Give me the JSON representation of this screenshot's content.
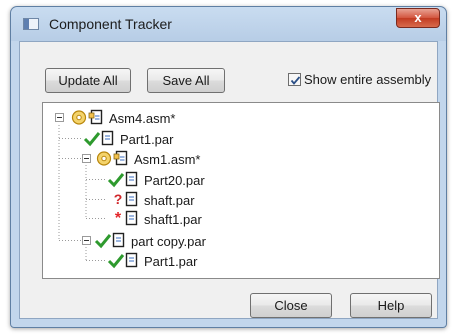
{
  "window": {
    "title": "Component Tracker",
    "close_glyph": "x"
  },
  "toolbar": {
    "update_all": "Update All",
    "save_all": "Save All",
    "show_entire_assembly": "Show entire assembly",
    "show_entire_assembly_checked": true
  },
  "tree": {
    "nodes": [
      {
        "label": "Asm4.asm*",
        "status": "out-of-date",
        "type": "assembly",
        "level": 0,
        "expanded": true
      },
      {
        "label": "Part1.par",
        "status": "up-to-date",
        "type": "part",
        "level": 1
      },
      {
        "label": "Asm1.asm*",
        "status": "out-of-date",
        "type": "assembly",
        "level": 1,
        "expanded": true
      },
      {
        "label": "Part20.par",
        "status": "up-to-date",
        "type": "part",
        "level": 2
      },
      {
        "label": "shaft.par",
        "status": "unknown",
        "type": "part",
        "level": 2
      },
      {
        "label": "shaft1.par",
        "status": "error",
        "type": "part",
        "level": 2
      },
      {
        "label": "part copy.par",
        "status": "up-to-date",
        "type": "part",
        "level": 1,
        "expanded": true
      },
      {
        "label": "Part1.par",
        "status": "up-to-date",
        "type": "part",
        "level": 2
      }
    ]
  },
  "footer": {
    "close": "Close",
    "help": "Help"
  },
  "icons": {
    "up_to_date": "check-icon",
    "unknown": "question-mark-icon",
    "error": "asterisk-icon",
    "out_of_date": "clock-icon",
    "document": "document-icon"
  },
  "colors": {
    "check_green": "#2e9a2e",
    "error_red": "#d0262a",
    "clock_gold": "#d9a520"
  }
}
